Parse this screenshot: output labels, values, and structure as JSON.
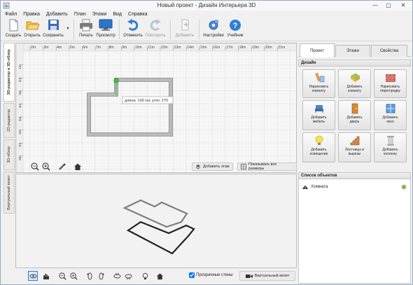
{
  "window": {
    "title": "Новый проект - Дизайн Интерьера 3D",
    "controls": {
      "minimize": "—",
      "maximize": "▢",
      "close": "✕"
    }
  },
  "menu": [
    "Файл",
    "Правка",
    "Добавить",
    "План",
    "Этажи",
    "Вид",
    "Справка"
  ],
  "toolbar": {
    "create": "Создать",
    "open": "Открыть",
    "save": "Сохранить",
    "print": "Печать",
    "preview": "Просмотр",
    "undo": "Отменить",
    "redo": "Повторить",
    "add": "Добавить",
    "settings": "Настройки",
    "tutorial": "Учебник"
  },
  "left_tabs": [
    "3D-редактор и 3D-обзор",
    "2D-редактор",
    "3D-обзор",
    "Виртуальный визит"
  ],
  "ruler": {
    "labels": [
      "2m",
      "3m",
      "4m",
      "5m",
      "6m",
      "7m",
      "8m",
      "9m",
      "10m",
      "11m",
      "12m",
      "13m",
      "14m",
      "15m",
      "16m",
      "17m",
      "18m",
      "19m",
      "20m",
      "21m"
    ],
    "vlabels": [
      "1m",
      "2m",
      "3m",
      "4m",
      "5m",
      "6m",
      "7m",
      "8m"
    ]
  },
  "editor": {
    "tooltip": "длина: 100 см; угол: 270",
    "add_floor": "Добавить этаж",
    "show_dimensions": "Показывать все размеры"
  },
  "bottom": {
    "transparent_walls": "Прозрачные стены",
    "transparent_walls_checked": true,
    "virtual_visit": "Виртуальный визит"
  },
  "panel": {
    "tabs": [
      "Проект",
      "Этажи",
      "Свойства"
    ],
    "active_tab": "Проект",
    "design_header": "Дизайн",
    "design_buttons": [
      {
        "label": "Нарисовать\nкомнату",
        "icon": "draw-room-icon"
      },
      {
        "label": "Добавить\nкомнату",
        "icon": "add-room-icon"
      },
      {
        "label": "Нарисовать\nперегородку",
        "icon": "draw-partition-icon"
      },
      {
        "label": "Добавить\nмебель",
        "icon": "add-furniture-icon"
      },
      {
        "label": "Добавить\nдверь",
        "icon": "add-door-icon"
      },
      {
        "label": "Добавить\nокно",
        "icon": "add-window-icon"
      },
      {
        "label": "Добавить\nосвещение",
        "icon": "add-lighting-icon"
      },
      {
        "label": "Лестницы и\nвырезы",
        "icon": "stairs-icon"
      },
      {
        "label": "Добавить\nколонну",
        "icon": "add-column-icon"
      }
    ],
    "objects_header": "Список объектов",
    "objects": [
      {
        "name": "Комната"
      }
    ]
  },
  "colors": {
    "accent_blue": "#2f7fd0",
    "selection_green": "#33cc33",
    "wall_gray": "#8a8a8a"
  }
}
